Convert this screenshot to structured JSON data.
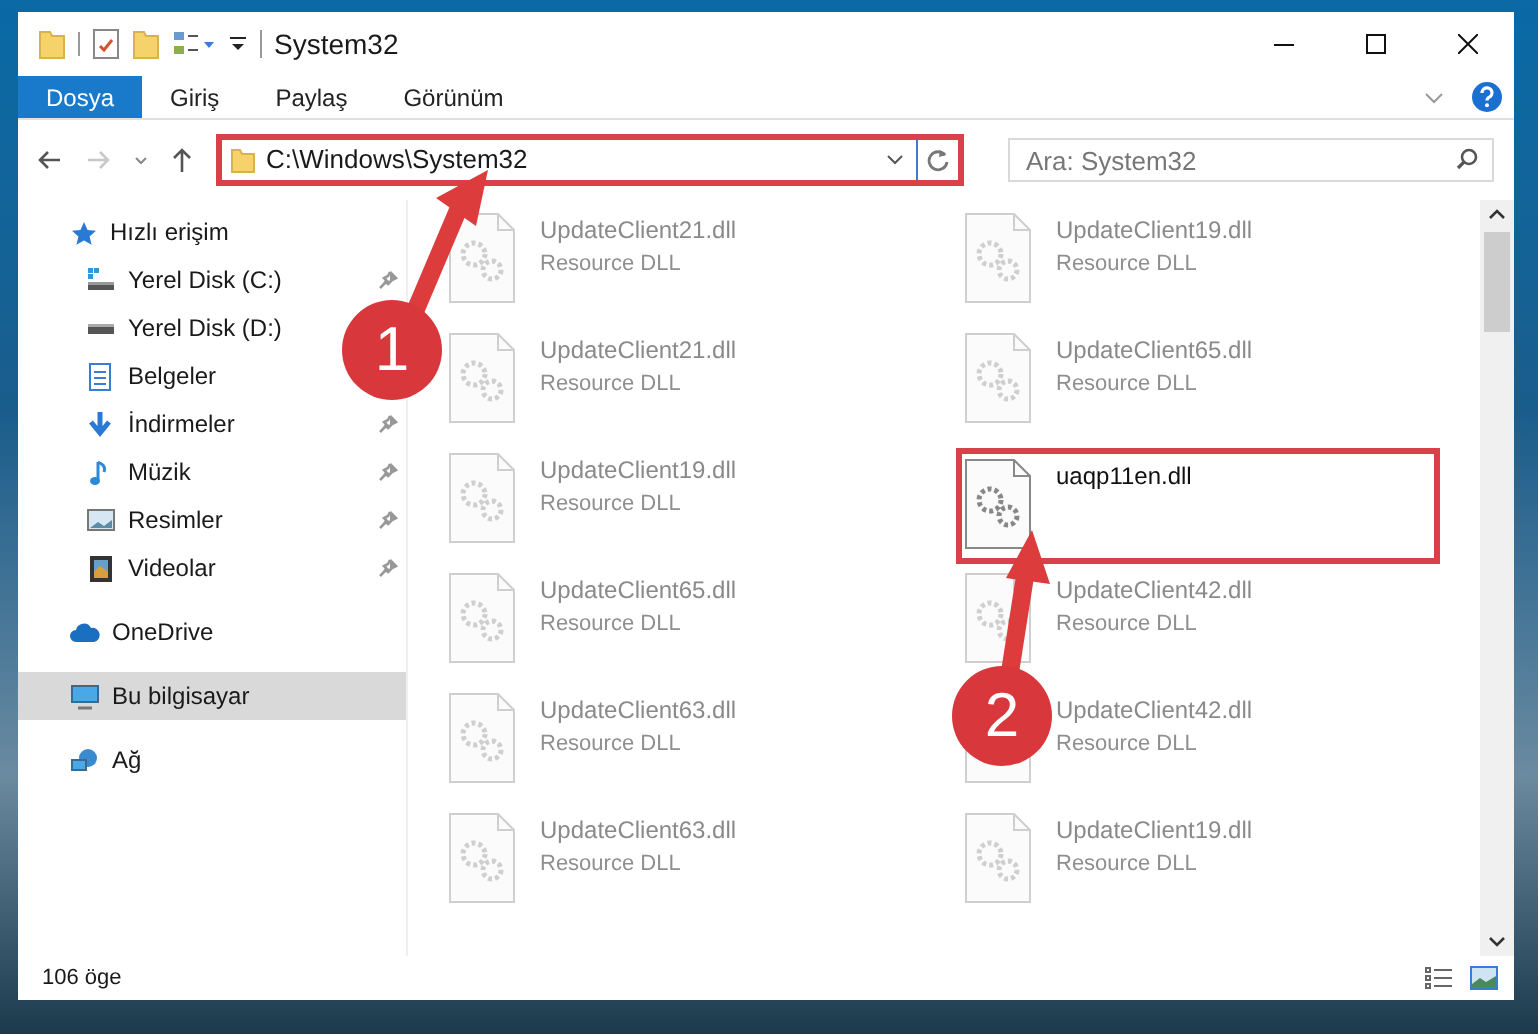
{
  "window": {
    "title": "System32"
  },
  "ribbon_tabs": [
    {
      "label": "Dosya",
      "selected": true
    },
    {
      "label": "Giriş",
      "selected": false
    },
    {
      "label": "Paylaş",
      "selected": false
    },
    {
      "label": "Görünüm",
      "selected": false
    }
  ],
  "address_bar": {
    "path": "C:\\Windows\\System32"
  },
  "search": {
    "placeholder": "Ara: System32"
  },
  "sidebar": {
    "items": [
      {
        "label": "Hızlı erişim",
        "selected": false,
        "children": [
          {
            "label": "Yerel Disk (C:)",
            "pinned": true,
            "selected": false
          },
          {
            "label": "Yerel Disk (D:)",
            "pinned": false,
            "selected": false
          },
          {
            "label": "Belgeler",
            "pinned": false,
            "selected": false
          },
          {
            "label": "İndirmeler",
            "pinned": true,
            "selected": false
          },
          {
            "label": "Müzik",
            "pinned": true,
            "selected": false
          },
          {
            "label": "Resimler",
            "pinned": true,
            "selected": false
          },
          {
            "label": "Videolar",
            "pinned": true,
            "selected": false
          }
        ]
      },
      {
        "label": "OneDrive",
        "selected": false
      },
      {
        "label": "Bu bilgisayar",
        "selected": true
      },
      {
        "label": "Ağ",
        "selected": false
      }
    ]
  },
  "files": [
    {
      "name": "UpdateClient21.dll",
      "type": "Resource DLL",
      "faded": true
    },
    {
      "name": "UpdateClient19.dll",
      "type": "Resource DLL",
      "faded": true
    },
    {
      "name": "UpdateClient21.dll",
      "type": "Resource DLL",
      "faded": true
    },
    {
      "name": "UpdateClient65.dll",
      "type": "Resource DLL",
      "faded": true
    },
    {
      "name": "UpdateClient19.dll",
      "type": "Resource DLL",
      "faded": true
    },
    {
      "name": "uaqp11en.dll",
      "faded": false
    },
    {
      "name": "UpdateClient65.dll",
      "type": "Resource DLL",
      "faded": true
    },
    {
      "name": "UpdateClient42.dll",
      "type": "Resource DLL",
      "faded": true
    },
    {
      "name": "UpdateClient63.dll",
      "type": "Resource DLL",
      "faded": true
    },
    {
      "name": "UpdateClient42.dll",
      "type": "Resource DLL",
      "faded": true
    },
    {
      "name": "UpdateClient63.dll",
      "type": "Resource DLL",
      "faded": true
    },
    {
      "name": "UpdateClient19.dll",
      "type": "Resource DLL",
      "faded": true
    }
  ],
  "annotations": [
    {
      "number": "1"
    },
    {
      "number": "2"
    }
  ],
  "status_bar": {
    "count": "106 öge"
  }
}
